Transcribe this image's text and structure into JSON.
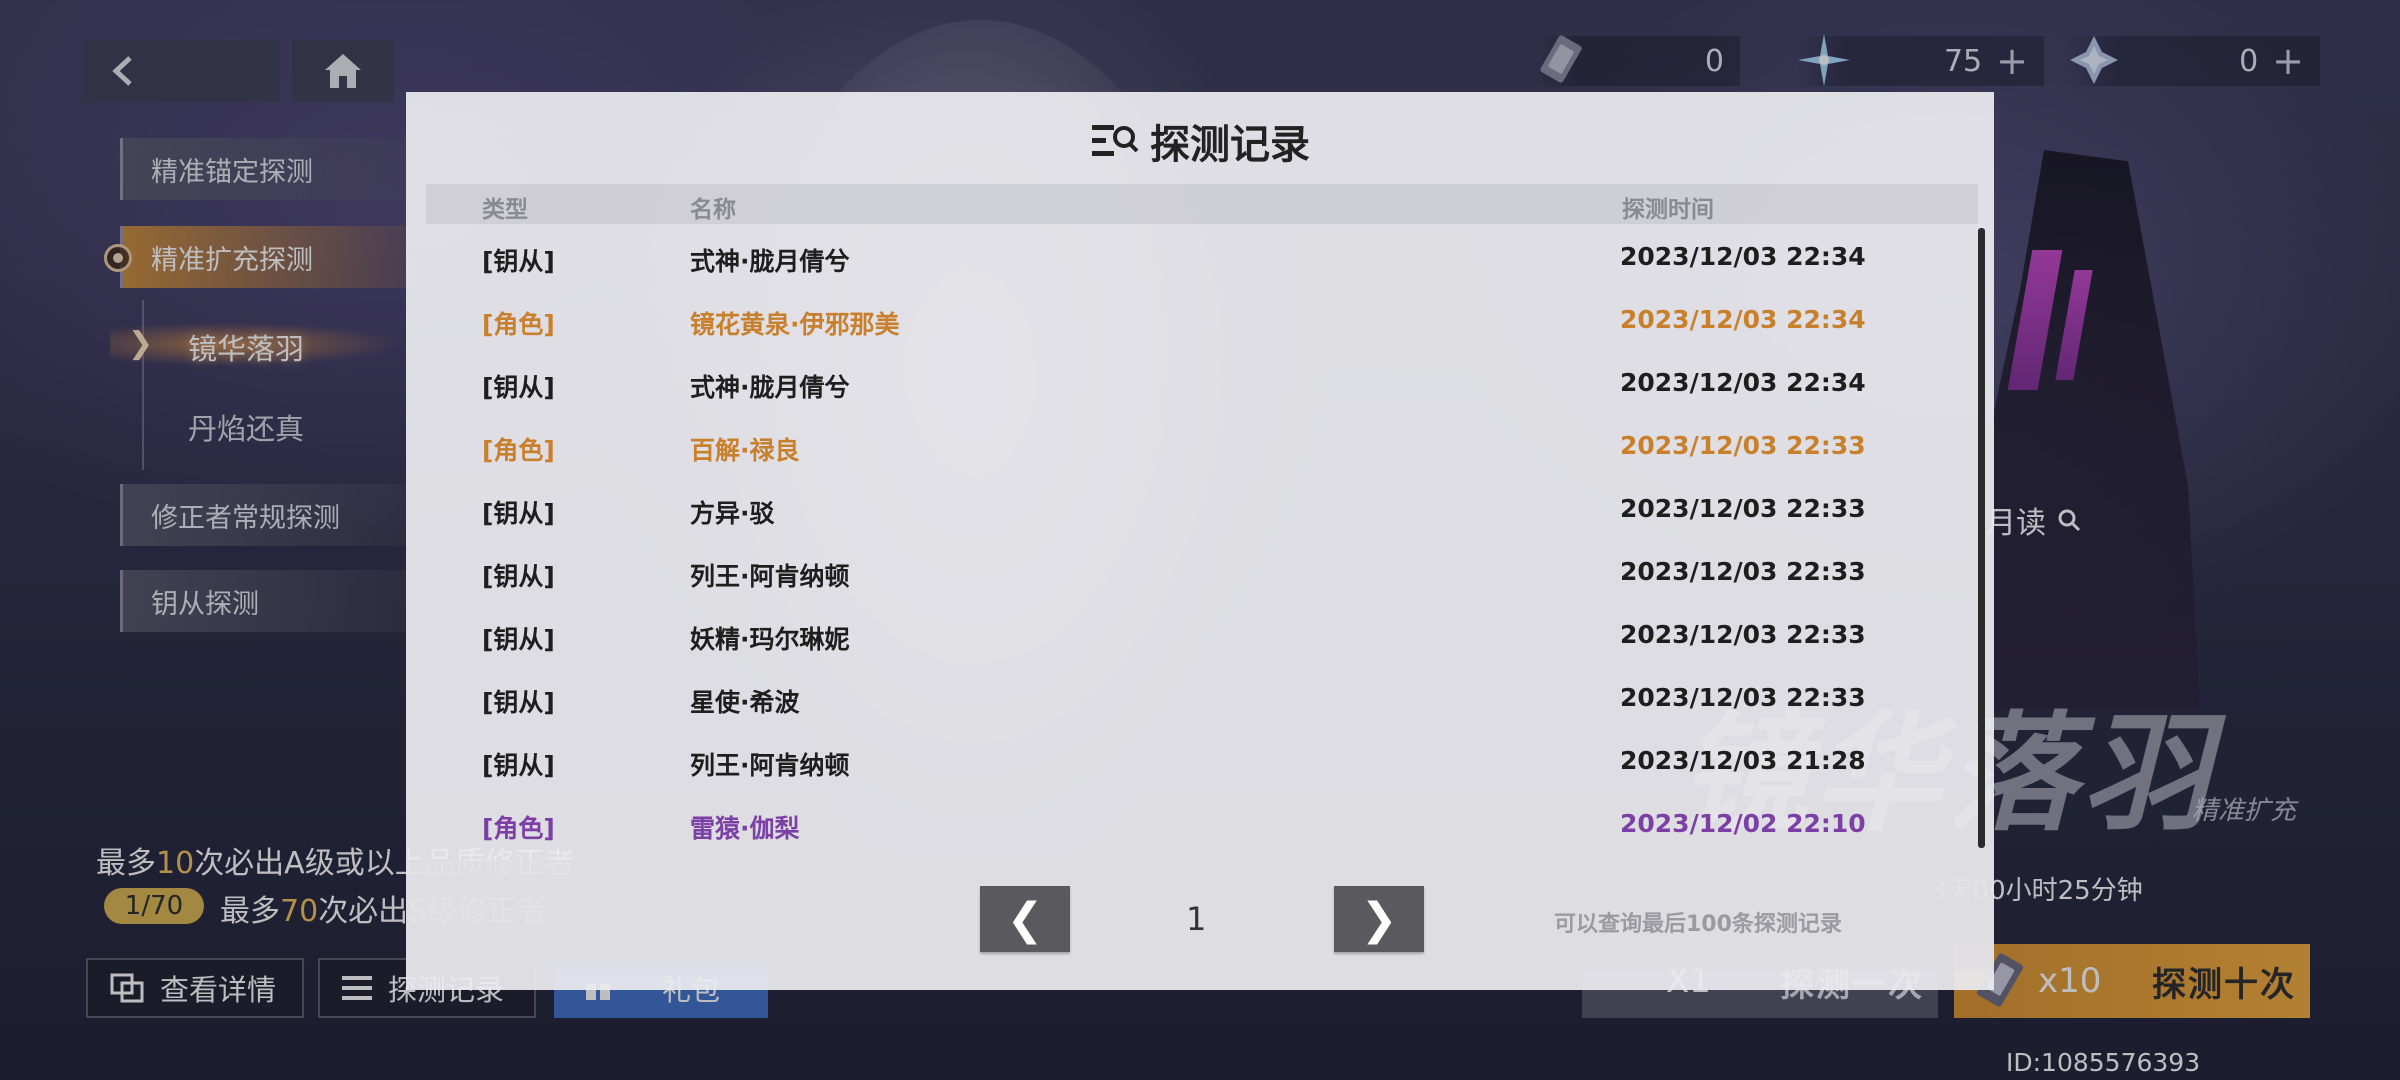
{
  "currencies": [
    {
      "icon": "ticket-icon",
      "value": "0",
      "plus": ""
    },
    {
      "icon": "star-crystal-icon",
      "value": "75",
      "plus": "+"
    },
    {
      "icon": "snow-crystal-icon",
      "value": "0",
      "plus": "+"
    }
  ],
  "menu": {
    "items": [
      {
        "label": "精准锚定探测"
      },
      {
        "label": "精准扩充探测"
      },
      {
        "label": "修正者常规探测"
      },
      {
        "label": "钥从探测"
      }
    ],
    "sub_items": [
      {
        "label": "镜华落羽"
      },
      {
        "label": "丹焰还真"
      }
    ]
  },
  "guarantee": {
    "line1_prefix": "最多",
    "line1_count": "10",
    "line1_suffix": "次必出A级或以上品质修正者",
    "pity": "1/70",
    "line2_prefix": "最多",
    "line2_count": "70",
    "line2_suffix": "次必出S级修正者"
  },
  "bottom_buttons": {
    "details": "查看详情",
    "records": "探测记录",
    "gift": "礼包"
  },
  "banner": {
    "title": "镜华落羽",
    "subtitle": "精准扩充",
    "featured": "月读",
    "countdown": "3天00小时25分钟"
  },
  "draw": {
    "single_count": "X1",
    "single_label": "探测一次",
    "ten_count": "x10",
    "ten_label": "探测十次"
  },
  "user_id": "ID:1085576393",
  "modal": {
    "title": "探测记录",
    "columns": {
      "type": "类型",
      "name": "名称",
      "time": "探测时间"
    },
    "rows": [
      {
        "type": "[钥从]",
        "name": "式神·胧月倩兮",
        "time": "2023/12/03 22:34",
        "rarity": "normal"
      },
      {
        "type": "[角色]",
        "name": "镜花黄泉·伊邪那美",
        "time": "2023/12/03 22:34",
        "rarity": "orange"
      },
      {
        "type": "[钥从]",
        "name": "式神·胧月倩兮",
        "time": "2023/12/03 22:34",
        "rarity": "normal"
      },
      {
        "type": "[角色]",
        "name": "百解·禄良",
        "time": "2023/12/03 22:33",
        "rarity": "orange"
      },
      {
        "type": "[钥从]",
        "name": "方异·驳",
        "time": "2023/12/03 22:33",
        "rarity": "normal"
      },
      {
        "type": "[钥从]",
        "name": "列王·阿肯纳顿",
        "time": "2023/12/03 22:33",
        "rarity": "normal"
      },
      {
        "type": "[钥从]",
        "name": "妖精·玛尔琳妮",
        "time": "2023/12/03 22:33",
        "rarity": "normal"
      },
      {
        "type": "[钥从]",
        "name": "星使·希波",
        "time": "2023/12/03 22:33",
        "rarity": "normal"
      },
      {
        "type": "[钥从]",
        "name": "列王·阿肯纳顿",
        "time": "2023/12/03 21:28",
        "rarity": "normal"
      },
      {
        "type": "[角色]",
        "name": "雷猿·伽梨",
        "time": "2023/12/02 22:10",
        "rarity": "purple"
      }
    ],
    "pager": {
      "prev": "❮",
      "page": "1",
      "next": "❯",
      "note": "可以查询最后100条探测记录"
    }
  },
  "colors": {
    "orange_rarity": "#c9802c",
    "purple_rarity": "#7b3fa6",
    "accent_gold": "#f2c15a",
    "draw_ten": "#f0aa3c"
  }
}
